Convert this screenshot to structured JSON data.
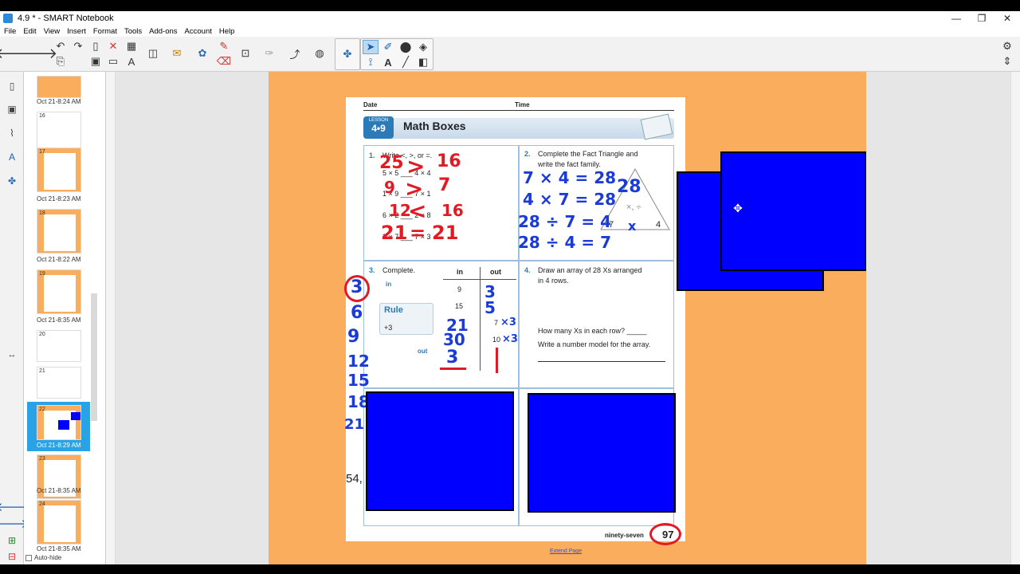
{
  "window": {
    "title": "4.9 * - SMART Notebook",
    "controls": [
      "—",
      "❐",
      "✕"
    ]
  },
  "menu": [
    "File",
    "Edit",
    "View",
    "Insert",
    "Format",
    "Tools",
    "Add-ons",
    "Account",
    "Help"
  ],
  "sorter": {
    "items": [
      {
        "num": "",
        "label": "Oct 21-8:24 AM"
      },
      {
        "num": "16",
        "label": ""
      },
      {
        "num": "17",
        "label": "Oct 21-8:23 AM"
      },
      {
        "num": "18",
        "label": "Oct 21-8:22 AM"
      },
      {
        "num": "19",
        "label": "Oct 21-8:35 AM"
      },
      {
        "num": "20",
        "label": ""
      },
      {
        "num": "21",
        "label": ""
      },
      {
        "num": "22",
        "label": "Oct 21-8:29 AM"
      },
      {
        "num": "23",
        "label": "Oct 21-8:35 AM"
      },
      {
        "num": "24",
        "label": "Oct 21-8:35 AM"
      }
    ],
    "autohide": "Auto-hide"
  },
  "worksheet": {
    "date_label": "Date",
    "time_label": "Time",
    "lesson_word": "LESSON",
    "lesson_num": "4•9",
    "title": "Math Boxes",
    "q1_num": "1.",
    "q1_text": "Write <, >, or =.",
    "q1_rows": [
      "5 × 5 ___ 4 × 4",
      "1 × 9 ___ 7 × 1",
      "6 × 2 ___ 2 × 8",
      "3 × 7 ___ 7 × 3"
    ],
    "q2_num": "2.",
    "q2_text1": "Complete the Fact Triangle and",
    "q2_text2": "write the fact family.",
    "q3_num": "3.",
    "q3_text": "Complete.",
    "q3_in": "in",
    "q3_out": "out",
    "q3_rule": "Rule",
    "q3_rule_val": "+3",
    "q3_col_in": "in",
    "q3_col_out": "out",
    "q3_vals": [
      "9",
      "15",
      "",
      "",
      ""
    ],
    "q3_out_vals": [
      "",
      "",
      "7",
      "10",
      ""
    ],
    "q4_num": "4.",
    "q4_text1": "Draw an array of 28 Xs arranged",
    "q4_text2": "in 4 rows.",
    "q4_text3": "How many Xs in each row? _____",
    "q4_text4": "Write a number model for the array.",
    "q5_partial": "54,",
    "footer_text": "ninety-seven",
    "page_num": "97",
    "triangle_vals": [
      "7",
      "4",
      "×, ÷"
    ]
  },
  "handwriting": {
    "q1_answers": [
      "25",
      ">",
      "16",
      "9",
      ">",
      "7",
      "12",
      "<",
      "16",
      "21",
      "=",
      "21"
    ],
    "q2_lines": [
      "7 × 4 = 28",
      "4 × 7 = 28",
      "28 ÷ 7 = 4",
      "28 ÷ 4 = 7"
    ],
    "q2_triangle_top": "28",
    "q2_triangle_x": "x",
    "q3_sequence": [
      "3",
      "6",
      "9",
      "12",
      "15",
      "18",
      "21"
    ],
    "q3_in_answers": [
      "21",
      "30",
      "3"
    ],
    "q3_out_answers": [
      "3",
      "5",
      "×3",
      "×3"
    ]
  },
  "canvas": {
    "extend_page": "Extend Page",
    "page_color": "#f9ad5d",
    "cover_color": "#0000ff"
  }
}
